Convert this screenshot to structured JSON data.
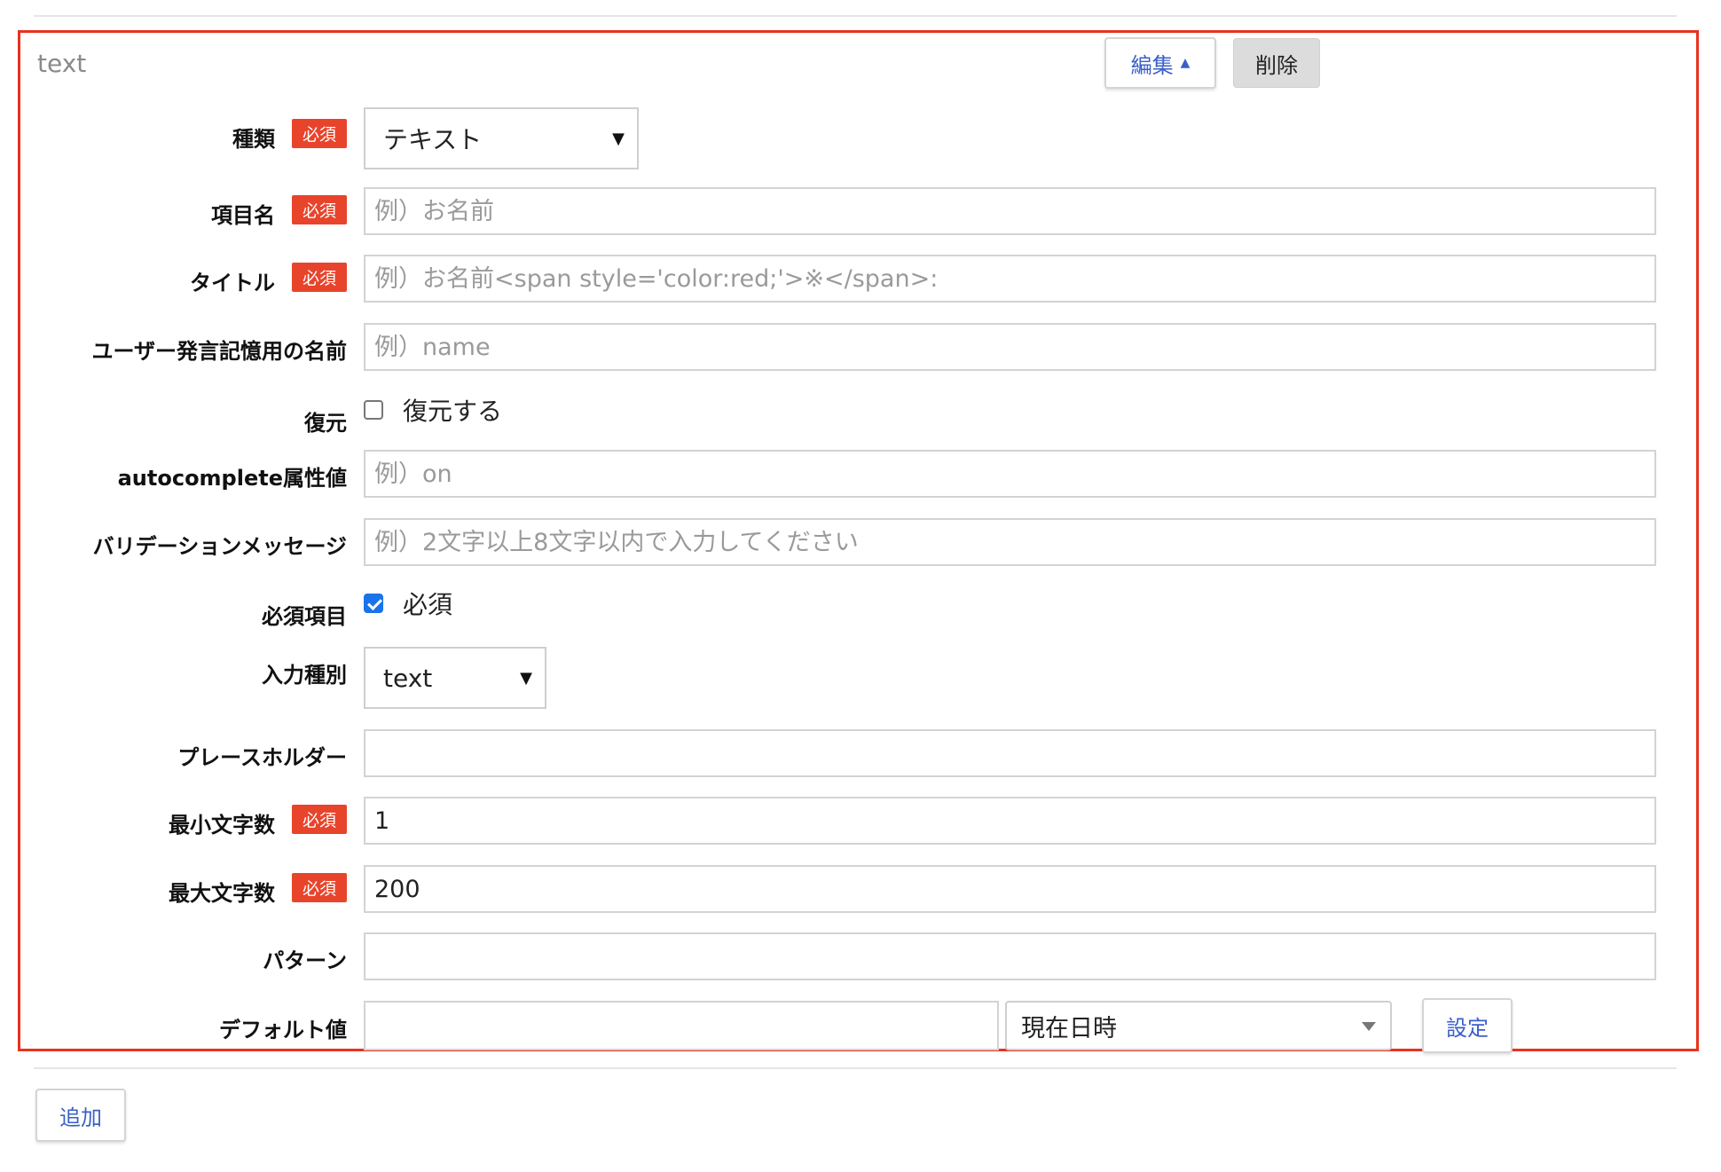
{
  "panel": {
    "title": "text",
    "edit_label": "編集",
    "edit_caret": "▲",
    "delete_label": "削除"
  },
  "required_badge": "必須",
  "fields": {
    "type": {
      "label": "種類",
      "value": "テキスト",
      "arrow": "▼"
    },
    "item_name": {
      "label": "項目名",
      "placeholder": "例）お名前"
    },
    "title": {
      "label": "タイトル",
      "placeholder": "例）お名前<span style='color:red;'>※</span>:"
    },
    "user_memory_name": {
      "label": "ユーザー発言記憶用の名前",
      "placeholder": "例）name"
    },
    "restore": {
      "label": "復元",
      "checkbox_label": "復元する",
      "checked": false
    },
    "autocomplete": {
      "label": "autocomplete属性値",
      "placeholder": "例）on"
    },
    "validation_message": {
      "label": "バリデーションメッセージ",
      "placeholder": "例）2文字以上8文字以内で入力してください"
    },
    "required_item": {
      "label": "必須項目",
      "checkbox_label": "必須",
      "checked": true
    },
    "input_type": {
      "label": "入力種別",
      "value": "text",
      "arrow": "▼"
    },
    "placeholder": {
      "label": "プレースホルダー",
      "value": ""
    },
    "min_chars": {
      "label": "最小文字数",
      "value": "1"
    },
    "max_chars": {
      "label": "最大文字数",
      "value": "200"
    },
    "pattern": {
      "label": "パターン",
      "value": ""
    },
    "default_value": {
      "label": "デフォルト値",
      "value": "",
      "select_value": "現在日時",
      "set_label": "設定"
    }
  },
  "add_label": "追加",
  "colors": {
    "required_badge": "#e8442b",
    "panel_border": "#e8321e",
    "link_blue": "#3a5fc8",
    "checkbox_blue": "#1a73e8"
  }
}
